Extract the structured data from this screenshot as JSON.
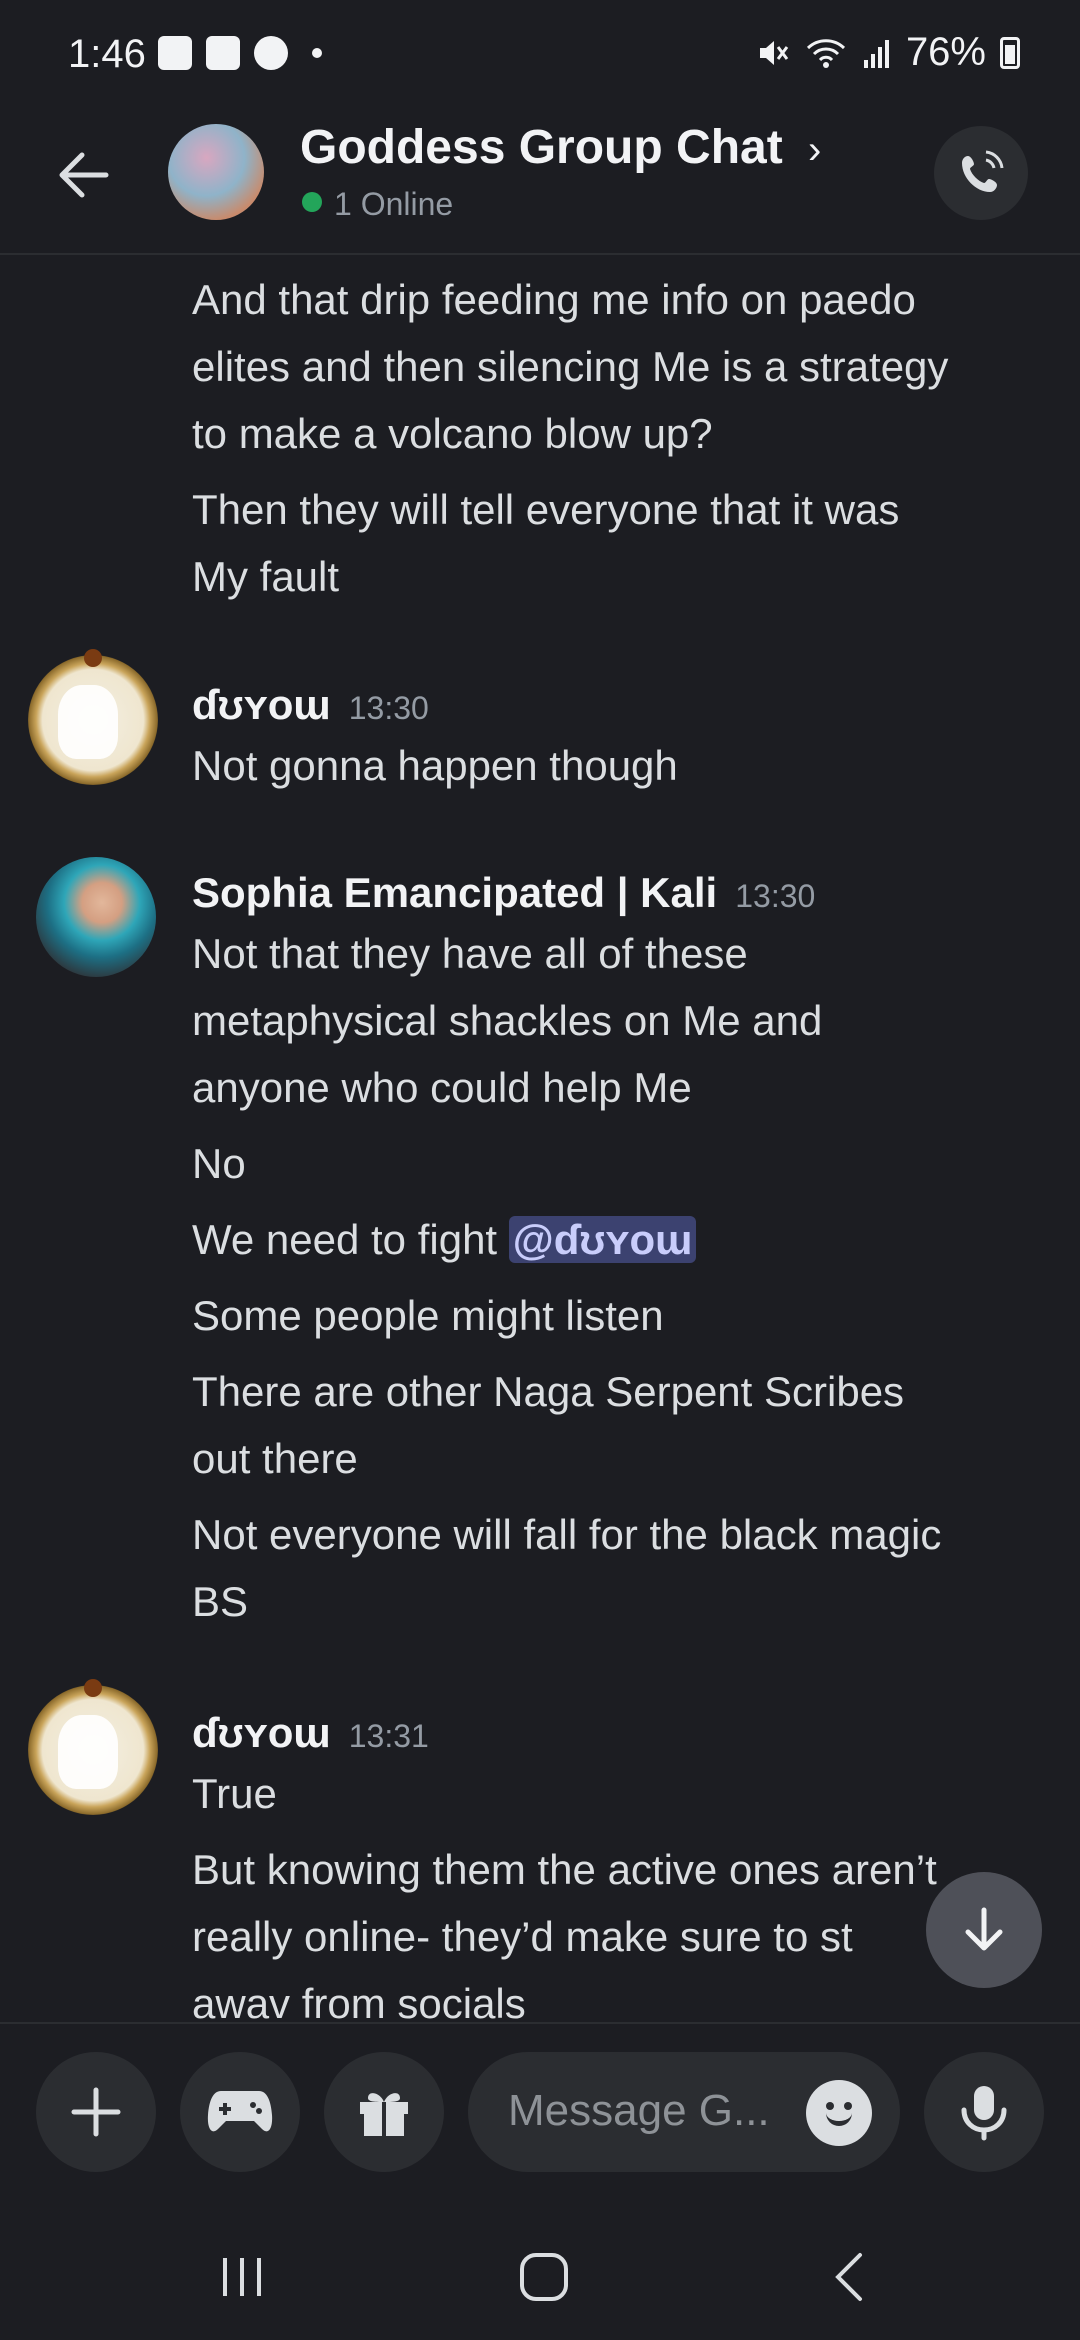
{
  "status_bar": {
    "time": "1:46",
    "battery": "76%",
    "notification_icons": [
      "gallery-icon",
      "calendar-icon",
      "youtube-icon"
    ],
    "system_icons": [
      "mute-icon",
      "wifi-icon",
      "signal-icon",
      "battery-icon"
    ]
  },
  "header": {
    "title": "Goddess Group Chat",
    "online_status": "1 Online",
    "online_color": "#23a55a"
  },
  "messages": {
    "continued_lines": [
      "And that drip feeding me info on paedo",
      "elites and then silencing Me is a strategy",
      "to make a volcano blow up?",
      "Then they will tell everyone that it was",
      "My fault"
    ],
    "group1": {
      "author": "ɗʊʏoɯ",
      "time": "13:30",
      "lines": [
        "Not gonna happen though"
      ]
    },
    "group2": {
      "author": "Sophia Emancipated | Kali",
      "time": "13:30",
      "lines": [
        "Not that they have all of these",
        "metaphysical shackles on Me and",
        "anyone who could help Me",
        "No",
        "We need to fight",
        "Some people might listen",
        "There are other Naga Serpent Scribes",
        "out there",
        "Not everyone will fall for the black magic",
        "BS"
      ],
      "mention": "@ɗʊʏoɯ"
    },
    "group3": {
      "author": "ɗʊʏoɯ",
      "time": "13:31",
      "lines": [
        "True",
        "But knowing them the active ones aren’t",
        "really online- they’d make sure to st",
        "awav from socials"
      ]
    }
  },
  "composer": {
    "placeholder": "Message G...",
    "buttons": [
      "plus-icon",
      "gamepad-icon",
      "gift-icon",
      "emoji-icon",
      "microphone-icon"
    ]
  },
  "colors": {
    "background": "#1c1d22",
    "surface": "#2b2d31",
    "mention_bg": "#3c4270",
    "mention_text": "#c9cdfb"
  }
}
